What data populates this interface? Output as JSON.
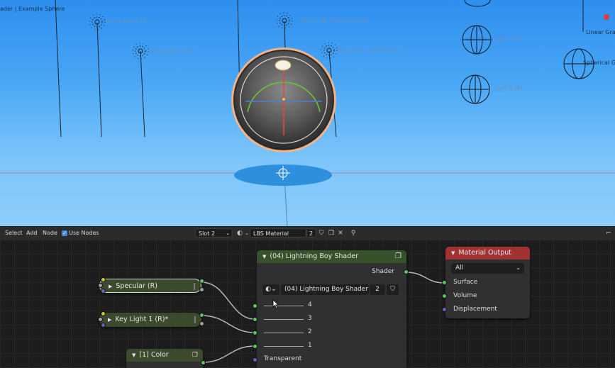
{
  "viewport": {
    "title": "ader | Example Sphere",
    "light_labels": [
      "Rim Light 7 (G)",
      "Rim Light 1 (B)",
      "Light 2 (B) (Background)",
      "Key Light 3 (B) (Extra)",
      "Light 2 (B)",
      "Light 3 (B)"
    ],
    "right_labels": [
      "Linear Gradi",
      "Spherical Gra"
    ]
  },
  "header": {
    "menu": [
      "Select",
      "Add",
      "Node"
    ],
    "use_nodes_label": "Use Nodes",
    "slot_value": "Slot 2",
    "material_name": "LBS Material",
    "users_count": "2"
  },
  "nodes": {
    "specular": {
      "label": "Specular (R)"
    },
    "key_light": {
      "label": "Key Light 1 (R)*"
    },
    "color": {
      "label": "[1] Color"
    },
    "shader": {
      "title": "(04) Lightning Boy Shader",
      "output_label": "Shader",
      "group_name": "(04) Lightning Boy Shader",
      "group_users": "2",
      "inputs": [
        "4",
        "3",
        "2",
        "1"
      ],
      "transparent_label": "Transparent"
    },
    "output": {
      "title": "Material Output",
      "target": "All",
      "sockets": [
        "Surface",
        "Volume",
        "Displacement"
      ]
    }
  },
  "colors": {
    "shader_header": "#36522a",
    "output_header": "#a13232",
    "socket_shader": "#62c462",
    "socket_vector": "#6363c7"
  }
}
